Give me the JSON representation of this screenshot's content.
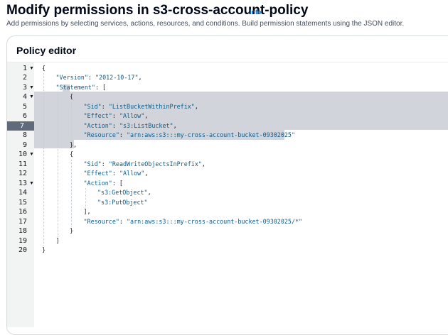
{
  "header": {
    "title": "Modify permissions in s3-cross-account-policy",
    "info_link": "Info",
    "description": "Add permissions by selecting services, actions, resources, and conditions. Build permission statements using the JSON editor."
  },
  "editor": {
    "title": "Policy editor",
    "active_line": 7,
    "lines": [
      {
        "n": "1",
        "fold": true,
        "indent": 0,
        "parts": [
          {
            "t": "{",
            "c": "p"
          }
        ]
      },
      {
        "n": "2",
        "fold": false,
        "indent": 1,
        "parts": [
          {
            "t": "\"Version\"",
            "c": "key"
          },
          {
            "t": ": ",
            "c": "p"
          },
          {
            "t": "\"2012-10-17\"",
            "c": "str"
          },
          {
            "t": ",",
            "c": "p"
          }
        ]
      },
      {
        "n": "3",
        "fold": true,
        "indent": 1,
        "parts": [
          {
            "t": "\"Statement\"",
            "c": "key"
          },
          {
            "t": ": [",
            "c": "p"
          }
        ]
      },
      {
        "n": "4",
        "fold": true,
        "indent": 2,
        "parts": [
          {
            "t": "{",
            "c": "p"
          }
        ]
      },
      {
        "n": "5",
        "fold": false,
        "indent": 3,
        "parts": [
          {
            "t": "\"Sid\"",
            "c": "key"
          },
          {
            "t": ": ",
            "c": "p"
          },
          {
            "t": "\"ListBucketWithinPrefix\"",
            "c": "str"
          },
          {
            "t": ",",
            "c": "p"
          }
        ]
      },
      {
        "n": "6",
        "fold": false,
        "indent": 3,
        "parts": [
          {
            "t": "\"Effect\"",
            "c": "key"
          },
          {
            "t": ": ",
            "c": "p"
          },
          {
            "t": "\"Allow\"",
            "c": "str"
          },
          {
            "t": ",",
            "c": "p"
          }
        ]
      },
      {
        "n": "7",
        "fold": false,
        "indent": 3,
        "parts": [
          {
            "t": "\"Action\"",
            "c": "key"
          },
          {
            "t": ": ",
            "c": "p"
          },
          {
            "t": "\"s3:ListBucket\"",
            "c": "str"
          },
          {
            "t": ",",
            "c": "p"
          }
        ]
      },
      {
        "n": "8",
        "fold": false,
        "indent": 3,
        "parts": [
          {
            "t": "\"Resource\"",
            "c": "key"
          },
          {
            "t": ": ",
            "c": "p"
          },
          {
            "t": "\"arn:aws:s3:::my-cross-account-bucket-09302025\"",
            "c": "str"
          }
        ]
      },
      {
        "n": "9",
        "fold": false,
        "indent": 2,
        "parts": [
          {
            "t": "},",
            "c": "p"
          }
        ]
      },
      {
        "n": "10",
        "fold": true,
        "indent": 2,
        "parts": [
          {
            "t": "{",
            "c": "p"
          }
        ]
      },
      {
        "n": "11",
        "fold": false,
        "indent": 3,
        "parts": [
          {
            "t": "\"Sid\"",
            "c": "key"
          },
          {
            "t": ": ",
            "c": "p"
          },
          {
            "t": "\"ReadWriteObjectsInPrefix\"",
            "c": "str"
          },
          {
            "t": ",",
            "c": "p"
          }
        ]
      },
      {
        "n": "12",
        "fold": false,
        "indent": 3,
        "parts": [
          {
            "t": "\"Effect\"",
            "c": "key"
          },
          {
            "t": ": ",
            "c": "p"
          },
          {
            "t": "\"Allow\"",
            "c": "str"
          },
          {
            "t": ",",
            "c": "p"
          }
        ]
      },
      {
        "n": "13",
        "fold": true,
        "indent": 3,
        "parts": [
          {
            "t": "\"Action\"",
            "c": "key"
          },
          {
            "t": ": [",
            "c": "p"
          }
        ]
      },
      {
        "n": "14",
        "fold": false,
        "indent": 4,
        "parts": [
          {
            "t": "\"s3:GetObject\"",
            "c": "str"
          },
          {
            "t": ",",
            "c": "p"
          }
        ]
      },
      {
        "n": "15",
        "fold": false,
        "indent": 4,
        "parts": [
          {
            "t": "\"s3:PutObject\"",
            "c": "str"
          }
        ]
      },
      {
        "n": "16",
        "fold": false,
        "indent": 3,
        "parts": [
          {
            "t": "],",
            "c": "p"
          }
        ]
      },
      {
        "n": "17",
        "fold": false,
        "indent": 3,
        "parts": [
          {
            "t": "\"Resource\"",
            "c": "key"
          },
          {
            "t": ": ",
            "c": "p"
          },
          {
            "t": "\"arn:aws:s3:::my-cross-account-bucket-09302025/*\"",
            "c": "str"
          }
        ]
      },
      {
        "n": "18",
        "fold": false,
        "indent": 2,
        "parts": [
          {
            "t": "}",
            "c": "p"
          }
        ]
      },
      {
        "n": "19",
        "fold": false,
        "indent": 1,
        "parts": [
          {
            "t": "]",
            "c": "p"
          }
        ]
      },
      {
        "n": "20",
        "fold": false,
        "indent": 0,
        "parts": [
          {
            "t": "}",
            "c": "p"
          }
        ]
      }
    ]
  }
}
